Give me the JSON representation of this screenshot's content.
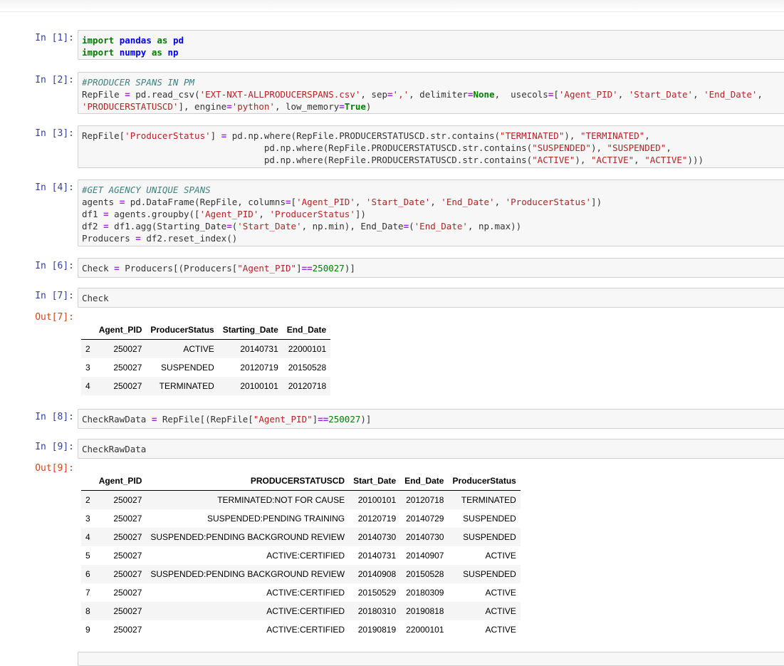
{
  "cells": [
    {
      "id": "c1",
      "prompt": "In [1]:"
    },
    {
      "id": "c2",
      "prompt": "In [2]:"
    },
    {
      "id": "c3",
      "prompt": "In [3]:"
    },
    {
      "id": "c4",
      "prompt": "In [4]:"
    },
    {
      "id": "c6",
      "prompt": "In [6]:"
    },
    {
      "id": "c7",
      "prompt": "In [7]:",
      "out_prompt": "Out[7]:"
    },
    {
      "id": "c8",
      "prompt": "In [8]:"
    },
    {
      "id": "c9",
      "prompt": "In [9]:",
      "out_prompt": "Out[9]:"
    }
  ],
  "code": {
    "c1": [
      [
        [
          "kw",
          "import"
        ],
        [
          "t",
          " "
        ],
        [
          "nm",
          "pandas"
        ],
        [
          "t",
          " "
        ],
        [
          "kw",
          "as"
        ],
        [
          "t",
          " "
        ],
        [
          "nm",
          "pd"
        ]
      ],
      [
        [
          "kw",
          "import"
        ],
        [
          "t",
          " "
        ],
        [
          "nm",
          "numpy"
        ],
        [
          "t",
          " "
        ],
        [
          "kw",
          "as"
        ],
        [
          "t",
          " "
        ],
        [
          "nm",
          "np"
        ]
      ]
    ],
    "c2": [
      [
        [
          "cm",
          "#PRODUCER SPANS IN PM"
        ]
      ],
      [
        [
          "t",
          "RepFile "
        ],
        [
          "op",
          "="
        ],
        [
          "t",
          " pd."
        ],
        [
          "t",
          "read_csv("
        ],
        [
          "str",
          "'EXT-NXT-ALLPRODUCERSPANS.csv'"
        ],
        [
          "t",
          ", sep"
        ],
        [
          "op",
          "="
        ],
        [
          "str",
          "','"
        ],
        [
          "t",
          ", delimiter"
        ],
        [
          "op",
          "="
        ],
        [
          "kw",
          "None"
        ],
        [
          "t",
          ",  usecols"
        ],
        [
          "op",
          "="
        ],
        [
          "t",
          "["
        ],
        [
          "str",
          "'Agent_PID'"
        ],
        [
          "t",
          ", "
        ],
        [
          "str",
          "'Start_Date'"
        ],
        [
          "t",
          ", "
        ],
        [
          "str",
          "'End_Date'"
        ],
        [
          "t",
          ","
        ]
      ],
      [
        [
          "str",
          "'PRODUCERSTATUSCD'"
        ],
        [
          "t",
          "], engine"
        ],
        [
          "op",
          "="
        ],
        [
          "str",
          "'python'"
        ],
        [
          "t",
          ", low_memory"
        ],
        [
          "op",
          "="
        ],
        [
          "kw",
          "True"
        ],
        [
          "t",
          ")"
        ]
      ]
    ],
    "c3": [
      [
        [
          "t",
          "RepFile["
        ],
        [
          "str",
          "'ProducerStatus'"
        ],
        [
          "t",
          "] "
        ],
        [
          "op",
          "="
        ],
        [
          "t",
          " pd.np.where(RepFile.PRODUCERSTATUSCD.str.contains("
        ],
        [
          "str",
          "\"TERMINATED\""
        ],
        [
          "t",
          "), "
        ],
        [
          "str",
          "\"TERMINATED\""
        ],
        [
          "t",
          ","
        ]
      ],
      [
        [
          "t",
          "                                  pd.np.where(RepFile.PRODUCERSTATUSCD.str.contains("
        ],
        [
          "str",
          "\"SUSPENDED\""
        ],
        [
          "t",
          "), "
        ],
        [
          "str",
          "\"SUSPENDED\""
        ],
        [
          "t",
          ","
        ]
      ],
      [
        [
          "t",
          "                                  pd.np.where(RepFile.PRODUCERSTATUSCD.str.contains("
        ],
        [
          "str",
          "\"ACTIVE\""
        ],
        [
          "t",
          "), "
        ],
        [
          "str",
          "\"ACTIVE\""
        ],
        [
          "t",
          ", "
        ],
        [
          "str",
          "\"ACTIVE\""
        ],
        [
          "t",
          ")))"
        ]
      ]
    ],
    "c4": [
      [
        [
          "cm",
          "#GET AGENCY UNIQUE SPANS"
        ]
      ],
      [
        [
          "t",
          "agents "
        ],
        [
          "op",
          "="
        ],
        [
          "t",
          " pd.DataFrame(RepFile, columns"
        ],
        [
          "op",
          "="
        ],
        [
          "t",
          "["
        ],
        [
          "str",
          "'Agent_PID'"
        ],
        [
          "t",
          ", "
        ],
        [
          "str",
          "'Start_Date'"
        ],
        [
          "t",
          ", "
        ],
        [
          "str",
          "'End_Date'"
        ],
        [
          "t",
          ", "
        ],
        [
          "str",
          "'ProducerStatus'"
        ],
        [
          "t",
          "])"
        ]
      ],
      [
        [
          "t",
          "df1 "
        ],
        [
          "op",
          "="
        ],
        [
          "t",
          " agents.groupby(["
        ],
        [
          "str",
          "'Agent_PID'"
        ],
        [
          "t",
          ", "
        ],
        [
          "str",
          "'ProducerStatus'"
        ],
        [
          "t",
          "])"
        ]
      ],
      [
        [
          "t",
          "df2 "
        ],
        [
          "op",
          "="
        ],
        [
          "t",
          " df1.agg(Starting_Date"
        ],
        [
          "op",
          "="
        ],
        [
          "t",
          "("
        ],
        [
          "str",
          "'Start_Date'"
        ],
        [
          "t",
          ", np.min), End_Date"
        ],
        [
          "op",
          "="
        ],
        [
          "t",
          "("
        ],
        [
          "str",
          "'End_Date'"
        ],
        [
          "t",
          ", np.max))"
        ]
      ],
      [
        [
          "t",
          "Producers "
        ],
        [
          "op",
          "="
        ],
        [
          "t",
          " df2.reset_index()"
        ]
      ]
    ],
    "c6": [
      [
        [
          "t",
          "Check "
        ],
        [
          "op",
          "="
        ],
        [
          "t",
          " Producers[(Producers["
        ],
        [
          "str",
          "\"Agent_PID\""
        ],
        [
          "t",
          "]"
        ],
        [
          "op",
          "=="
        ],
        [
          "num",
          "250027"
        ],
        [
          "t",
          ")]"
        ]
      ]
    ],
    "c7": [
      [
        [
          "t",
          "Check"
        ]
      ]
    ],
    "c8": [
      [
        [
          "t",
          "CheckRawData "
        ],
        [
          "op",
          "="
        ],
        [
          "t",
          " RepFile[(RepFile["
        ],
        [
          "str",
          "\"Agent_PID\""
        ],
        [
          "t",
          "]"
        ],
        [
          "op",
          "=="
        ],
        [
          "num",
          "250027"
        ],
        [
          "t",
          ")]"
        ]
      ]
    ],
    "c9": [
      [
        [
          "t",
          "CheckRawData"
        ]
      ]
    ]
  },
  "tables": {
    "check": {
      "columns": [
        "",
        "Agent_PID",
        "ProducerStatus",
        "Starting_Date",
        "End_Date"
      ],
      "rows": [
        [
          "2",
          "250027",
          "ACTIVE",
          "20140731",
          "22000101"
        ],
        [
          "3",
          "250027",
          "SUSPENDED",
          "20120719",
          "20150528"
        ],
        [
          "4",
          "250027",
          "TERMINATED",
          "20100101",
          "20120718"
        ]
      ]
    },
    "raw": {
      "columns": [
        "",
        "Agent_PID",
        "PRODUCERSTATUSCD",
        "Start_Date",
        "End_Date",
        "ProducerStatus"
      ],
      "rows": [
        [
          "2",
          "250027",
          "TERMINATED:NOT FOR CAUSE",
          "20100101",
          "20120718",
          "TERMINATED"
        ],
        [
          "3",
          "250027",
          "SUSPENDED:PENDING TRAINING",
          "20120719",
          "20140729",
          "SUSPENDED"
        ],
        [
          "4",
          "250027",
          "SUSPENDED:PENDING BACKGROUND REVIEW",
          "20140730",
          "20140730",
          "SUSPENDED"
        ],
        [
          "5",
          "250027",
          "ACTIVE:CERTIFIED",
          "20140731",
          "20140907",
          "ACTIVE"
        ],
        [
          "6",
          "250027",
          "SUSPENDED:PENDING BACKGROUND REVIEW",
          "20140908",
          "20150528",
          "SUSPENDED"
        ],
        [
          "7",
          "250027",
          "ACTIVE:CERTIFIED",
          "20150529",
          "20180309",
          "ACTIVE"
        ],
        [
          "8",
          "250027",
          "ACTIVE:CERTIFIED",
          "20180310",
          "20190818",
          "ACTIVE"
        ],
        [
          "9",
          "250027",
          "ACTIVE:CERTIFIED",
          "20190819",
          "22000101",
          "ACTIVE"
        ]
      ]
    }
  }
}
